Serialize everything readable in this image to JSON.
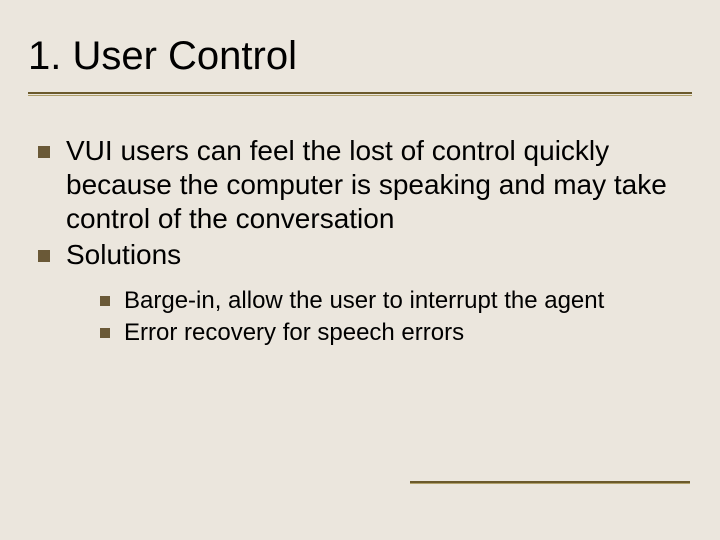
{
  "title": "1. User Control",
  "bullets": [
    {
      "text": "VUI users can feel the lost of control quickly because the computer is speaking and may take control of the conversation"
    },
    {
      "text": "Solutions",
      "children": [
        {
          "text": "Barge-in, allow the user to interrupt the agent"
        },
        {
          "text": "Error recovery for speech errors"
        }
      ]
    }
  ]
}
